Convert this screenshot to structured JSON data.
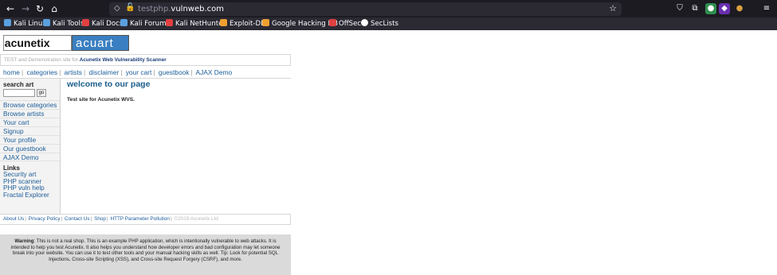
{
  "browser": {
    "url_prefix": "testphp.",
    "url_host": "vulnweb.com",
    "nav": [
      "←",
      "→",
      "↻",
      "⌂"
    ],
    "icons": [
      "shield-icon",
      "lock-insecure-icon",
      "star-icon",
      "pocket-icon",
      "extensions-icon",
      "account-icon",
      "menu-icon"
    ]
  },
  "bookmarks": [
    {
      "label": "Kali Linux",
      "color": "#5aa0e0"
    },
    {
      "label": "Kali Tools",
      "color": "#5aa0e0"
    },
    {
      "label": "Kali Docs",
      "color": "#e04040"
    },
    {
      "label": "Kali Forums",
      "color": "#5aa0e0"
    },
    {
      "label": "Kali NetHunter",
      "color": "#e04040"
    },
    {
      "label": "Exploit-DB",
      "color": "#f0a030"
    },
    {
      "label": "Google Hacking DB",
      "color": "#f0a030"
    },
    {
      "label": "OffSec",
      "color": "#e04040"
    },
    {
      "label": "SecLists",
      "color": "#ffffff"
    }
  ],
  "site": {
    "logo_left": "acunetix",
    "logo_right": "acuart",
    "tagline_prefix": "TEST and Demonstration site for ",
    "tagline_link": "Acunetix Web Vulnerability Scanner",
    "menu": [
      "home",
      "categories",
      "artists",
      "disclaimer",
      "your cart",
      "guestbook",
      "AJAX Demo"
    ],
    "search_title": "search art",
    "search_value": "",
    "go_label": "go",
    "side_items": [
      "Browse categories",
      "Browse artists",
      "Your cart",
      "Signup",
      "Your profile",
      "Our guestbook",
      "AJAX Demo"
    ],
    "links_title": "Links",
    "links": [
      "Security art",
      "PHP scanner",
      "PHP vuln help",
      "Fractal Explorer"
    ],
    "welcome": "welcome to our page",
    "intro": "Test site for Acunetix WVS.",
    "footer": [
      "About Us",
      "Privacy Policy",
      "Contact Us",
      "Shop",
      "HTTP Parameter Pollution"
    ],
    "copyright": "©2019 Acunetix Ltd",
    "warning_label": "Warning",
    "warning_text": ": This is not a real shop. This is an example PHP application, which is intentionally vulnerable to web attacks. It is intended to help you test Acunetix. It also helps you understand how developer errors and bad configuration may let someone break into your website. You can use it to test other tools and your manual hacking skills as well. Tip: Look for potential SQL Injections, Cross-site Scripting (XSS), and Cross-site Request Forgery (CSRF), and more."
  }
}
